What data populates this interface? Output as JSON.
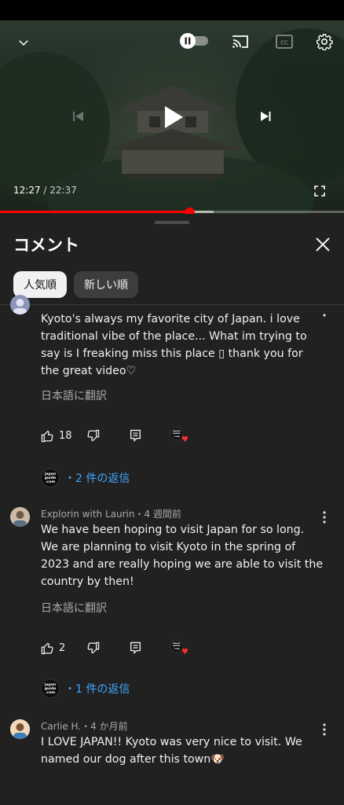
{
  "player": {
    "current_time": "12:27",
    "separator": " / ",
    "duration": "22:37",
    "progress_fraction": 0.55,
    "buffered_fraction": 0.62
  },
  "comments_panel": {
    "title": "コメント",
    "sort_chips": [
      {
        "label": "人気順",
        "selected": true
      },
      {
        "label": "新しい順",
        "selected": false
      }
    ]
  },
  "comments": [
    {
      "author": "",
      "text": "Kyoto's always my favorite city of Japan. i love traditional vibe of the place... What im trying to say is I freaking miss this place ▯ thank you for the great video♡",
      "translate_label": "日本語に翻訳",
      "likes": "18",
      "replies_label": "・2 件の返信"
    },
    {
      "author": "Explorin with Laurin・4 週間前",
      "text": "We have been hoping to visit Japan for so long. We are planning to visit Kyoto in the spring of 2023 and are really hoping we are able to visit the country by then!",
      "translate_label": "日本語に翻訳",
      "likes": "2",
      "replies_label": "・1 件の返信"
    },
    {
      "author": "Carlie H.・4 か月前",
      "text": "I LOVE JAPAN!! Kyoto was very nice to visit. We named our dog after this town🐶"
    }
  ],
  "channel_logo_text": "japan guide .com",
  "colors": {
    "accent_red": "#ff0000",
    "link_blue": "#3ea6ff",
    "background": "#212121",
    "heart": "#ff2d2d"
  }
}
